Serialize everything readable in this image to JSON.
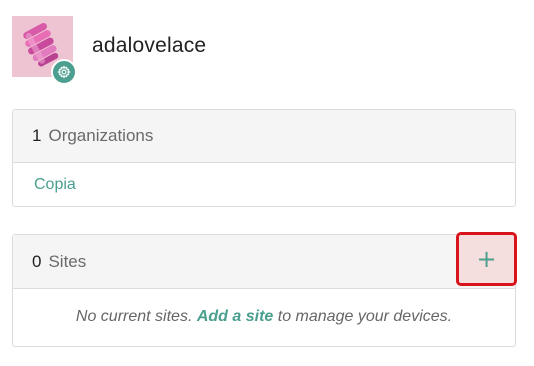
{
  "profile": {
    "username": "adalovelace",
    "avatar_icon": "avatar-image",
    "settings_icon": "gear-icon"
  },
  "organizations": {
    "count": "1",
    "title": "Organizations",
    "items": [
      "Copia"
    ]
  },
  "sites": {
    "count": "0",
    "title": "Sites",
    "add_icon": "plus-icon",
    "add_symbol": "+",
    "empty_prefix": "No current sites.",
    "empty_link": "Add a site",
    "empty_suffix": "to manage your devices."
  },
  "colors": {
    "accent": "#4a9f8e",
    "highlight_border": "#d9131c",
    "highlight_fill": "#f5dede",
    "header_bg": "#f5f5f5",
    "avatar_bg": "#eec3d2"
  }
}
